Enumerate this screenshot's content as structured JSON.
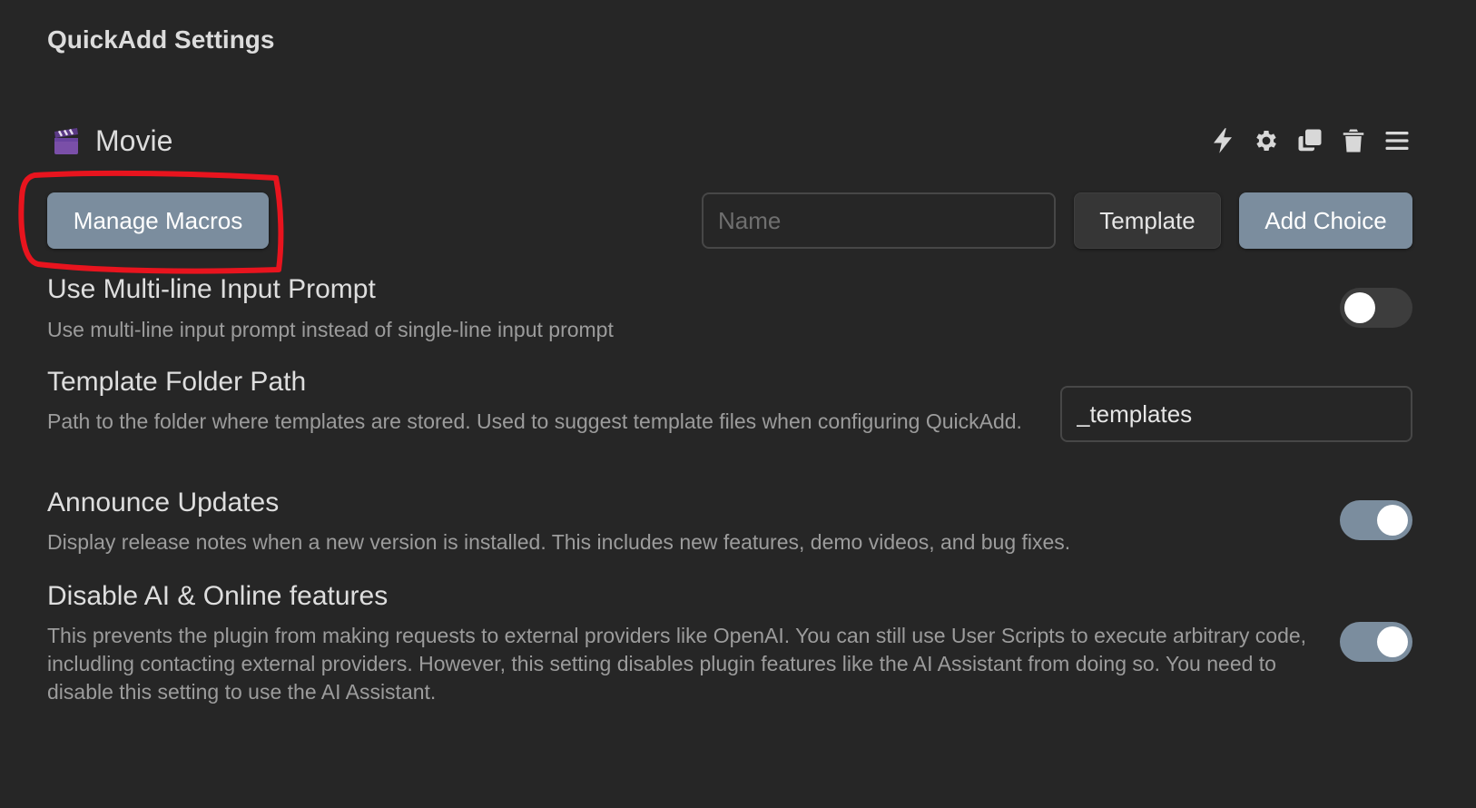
{
  "page": {
    "title": "QuickAdd Settings"
  },
  "choice": {
    "emoji": "🎬",
    "name": "Movie",
    "actions": [
      "lightning-icon",
      "gear-icon",
      "duplicate-icon",
      "trash-icon",
      "drag-handle-icon"
    ]
  },
  "toolbar": {
    "manage_macros_label": "Manage Macros",
    "name_placeholder": "Name",
    "name_value": "",
    "template_label": "Template",
    "add_choice_label": "Add Choice"
  },
  "settings": [
    {
      "name": "Use Multi-line Input Prompt",
      "description": "Use multi-line input prompt instead of single-line input prompt",
      "control": "toggle",
      "enabled": false
    },
    {
      "name": "Template Folder Path",
      "description": "Path to the folder where templates are stored. Used to suggest template files when configuring QuickAdd.",
      "control": "text",
      "value": "_templates"
    },
    {
      "name": "Announce Updates",
      "description": "Display release notes when a new version is installed. This includes new features, demo videos, and bug fixes.",
      "control": "toggle",
      "enabled": true
    },
    {
      "name": "Disable AI & Online features",
      "description": "This prevents the plugin from making requests to external providers like OpenAI. You can still use User Scripts to execute arbitrary code, includling contacting external providers. However, this setting disables plugin features like the AI Assistant from doing so. You need to disable this setting to use the AI Assistant.",
      "control": "toggle",
      "enabled": true
    }
  ],
  "colors": {
    "background": "#262626",
    "accent": "#7b8d9e",
    "annotation": "#e8141e"
  }
}
